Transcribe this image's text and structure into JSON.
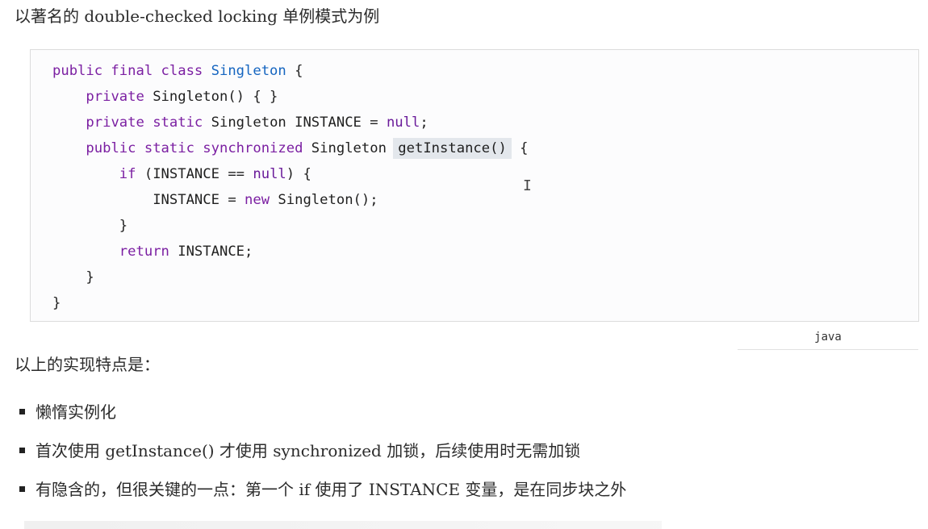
{
  "intro": "以著名的 double-checked locking 单例模式为例",
  "code": {
    "line1": {
      "kw": "public final class",
      "cls": "Singleton",
      "rest": " {"
    },
    "line2": {
      "indent": "    ",
      "kw": "private",
      "rest": " Singleton() { }"
    },
    "line3": {
      "indent": "    ",
      "kw": "private static",
      "mid": " Singleton INSTANCE = ",
      "kw2": "null",
      "rest": ";"
    },
    "line4": {
      "indent": "    ",
      "kw": "public static synchronized",
      "mid": " Singleton ",
      "hl": "getInstance()",
      "rest": " {"
    },
    "line5": {
      "indent": "        ",
      "kw": "if",
      "mid": " (INSTANCE == ",
      "kw2": "null",
      "rest": ") {"
    },
    "line6": {
      "indent": "            ",
      "pre": "INSTANCE = ",
      "kw": "new",
      "rest": " Singleton();"
    },
    "line7": "        }",
    "line8": {
      "indent": "        ",
      "kw": "return",
      "rest": " INSTANCE;"
    },
    "line9": "    }",
    "line10": "}"
  },
  "lang_label": "java",
  "cursor_glyph": "I",
  "summary": "以上的实现特点是：",
  "bullets": [
    "懒惰实例化",
    "首次使用 getInstance() 才使用 synchronized 加锁，后续使用时无需加锁",
    "有隐含的，但很关键的一点：第一个 if 使用了 INSTANCE 变量，是在同步块之外"
  ]
}
